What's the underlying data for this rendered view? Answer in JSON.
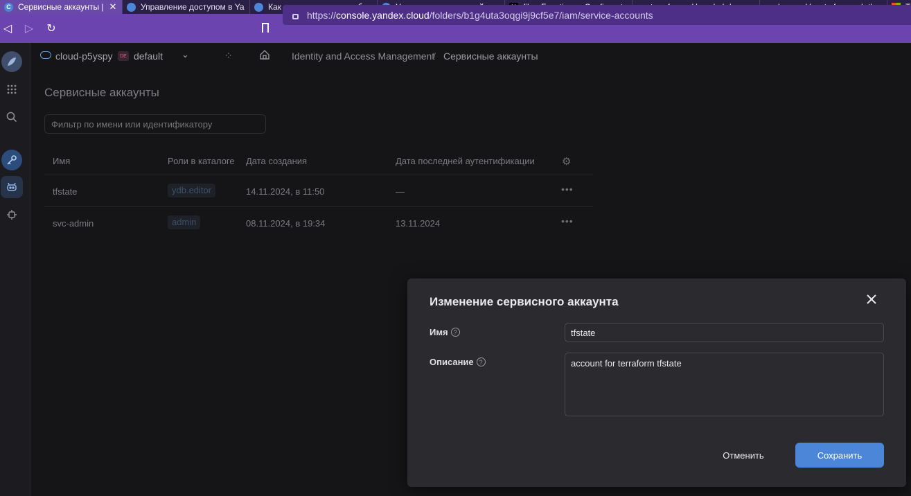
{
  "browser": {
    "tabs": [
      {
        "label": "Сервисные аккаунты |",
        "active": true,
        "icon": "yandex-cloud-icon",
        "color": "#4c86d8"
      },
      {
        "label": "Управление доступом в Ya",
        "icon": "yandex-cloud-icon",
        "color": "#4c86d8"
      },
      {
        "label": "Как получить список публ",
        "icon": "yandex-cloud-icon",
        "color": "#4c86d8"
      },
      {
        "label": "Управление политикой до",
        "icon": "yandex-cloud-icon",
        "color": "#4c86d8"
      },
      {
        "label": "file - Functions - Configurat",
        "icon": "terraform-icon",
        "color": "#ffffff"
      },
      {
        "label": "terraform - How do I do var",
        "icon": "stackoverflow-icon",
        "color": "#f48024"
      },
      {
        "label": "loops - How to for_each thr",
        "icon": "stackoverflow-icon",
        "color": "#f48024"
      },
      {
        "label": "T",
        "icon": "microsoft-icon",
        "color": "#f25022"
      }
    ],
    "url_prefix": "https://",
    "url_host": "console.yandex.cloud",
    "url_path": "/folders/b1g4uta3oqgi9j9cf5e7/iam/service-accounts"
  },
  "header": {
    "cloud": "cloud-p5yspy",
    "folder_badge": "DE",
    "folder": "default",
    "breadcrumb_service": "Identity and Access Management",
    "breadcrumb_sep": "/",
    "breadcrumb_page": "Сервисные аккаунты"
  },
  "main": {
    "title": "Сервисные аккаунты",
    "filter_placeholder": "Фильтр по имени или идентификатору",
    "columns": [
      "Имя",
      "Роли в каталоге",
      "Дата создания",
      "Дата последней аутентификации"
    ],
    "rows": [
      {
        "name": "tfstate",
        "role": "ydb.editor",
        "created": "14.11.2024, в 11:50",
        "last_auth": "—"
      },
      {
        "name": "svc-admin",
        "role": "admin",
        "created": "08.11.2024, в 19:34",
        "last_auth": "13.11.2024"
      }
    ]
  },
  "dialog": {
    "title": "Изменение сервисного аккаунта",
    "name_label": "Имя",
    "name_value": "tfstate",
    "description_label": "Описание",
    "description_value": "account for terraform tfstate",
    "help_glyph": "?",
    "cancel": "Отменить",
    "save": "Сохранить"
  },
  "colors": {
    "accent": "#4c86d8",
    "browser_bar": "#6c44b0"
  }
}
